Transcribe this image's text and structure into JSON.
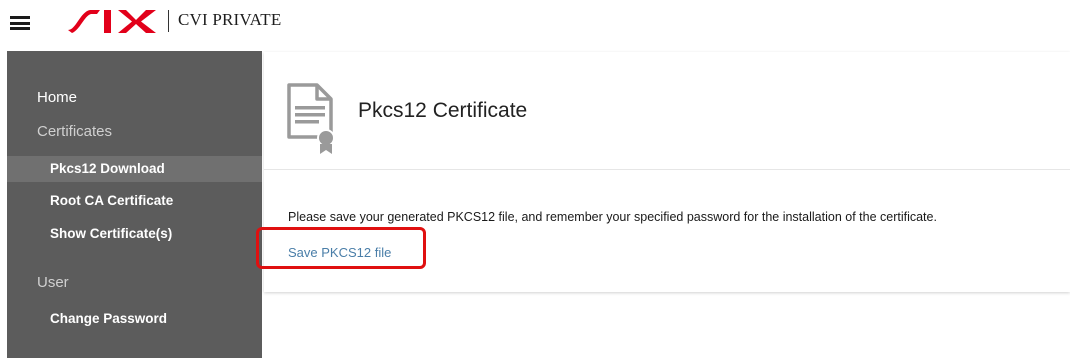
{
  "header": {
    "menu_icon": "hamburger-menu-icon",
    "logo_text": "SIX",
    "app_title": "CVI PRIVATE"
  },
  "sidebar": {
    "home": "Home",
    "certificates_heading": "Certificates",
    "items": [
      {
        "label": "Pkcs12 Download",
        "active": true
      },
      {
        "label": "Root CA Certificate",
        "active": false
      },
      {
        "label": "Show Certificate(s)",
        "active": false
      }
    ],
    "user_heading": "User",
    "user_items": [
      {
        "label": "Change Password"
      }
    ]
  },
  "main": {
    "icon": "certificate-document-icon",
    "title": "Pkcs12 Certificate",
    "message": "Please save your generated PKCS12 file, and remember your specified password for the installation of the certificate.",
    "save_link": "Save PKCS12 file"
  },
  "colors": {
    "sidebar_bg": "#5c5c5c",
    "sidebar_active": "#707070",
    "logo_red": "#e2001a",
    "link": "#4a7ea8",
    "highlight": "#e01010"
  }
}
